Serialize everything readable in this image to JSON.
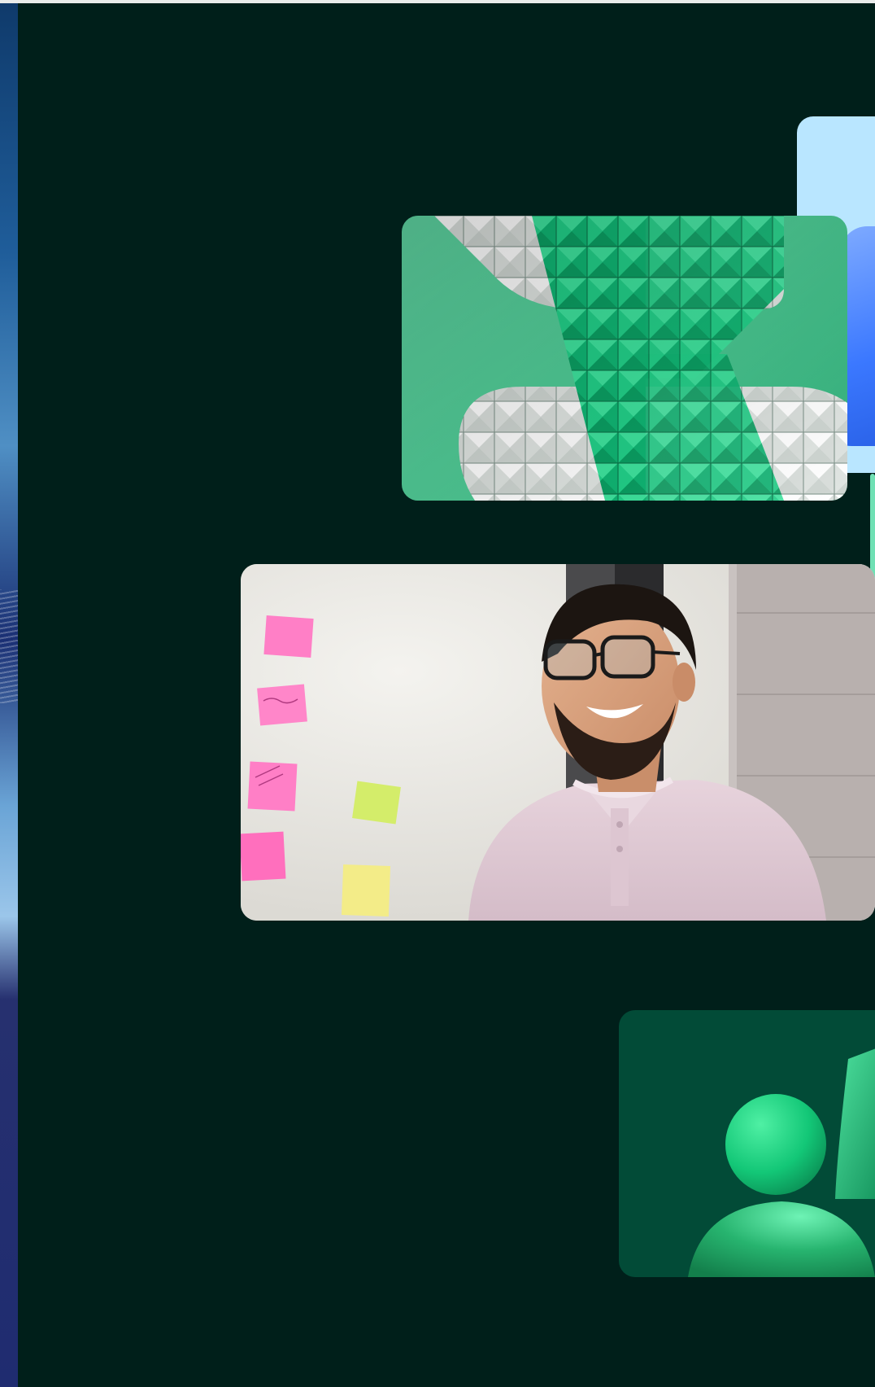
{
  "page": {
    "background_color": "#001f1a",
    "accent_colors": [
      "#5fd6a3",
      "#b9e6ff",
      "#2f6dff",
      "#024b37"
    ]
  },
  "cards": [
    {
      "name": "blue-abstract-card",
      "icon": "abstract-blue-shape-icon"
    },
    {
      "name": "green-geometric-card",
      "icon": "pyramid-pattern-icon"
    },
    {
      "name": "photo-card",
      "icon": "smiling-man-photo"
    },
    {
      "name": "avatar-card",
      "icon": "person-avatar-icon"
    }
  ]
}
